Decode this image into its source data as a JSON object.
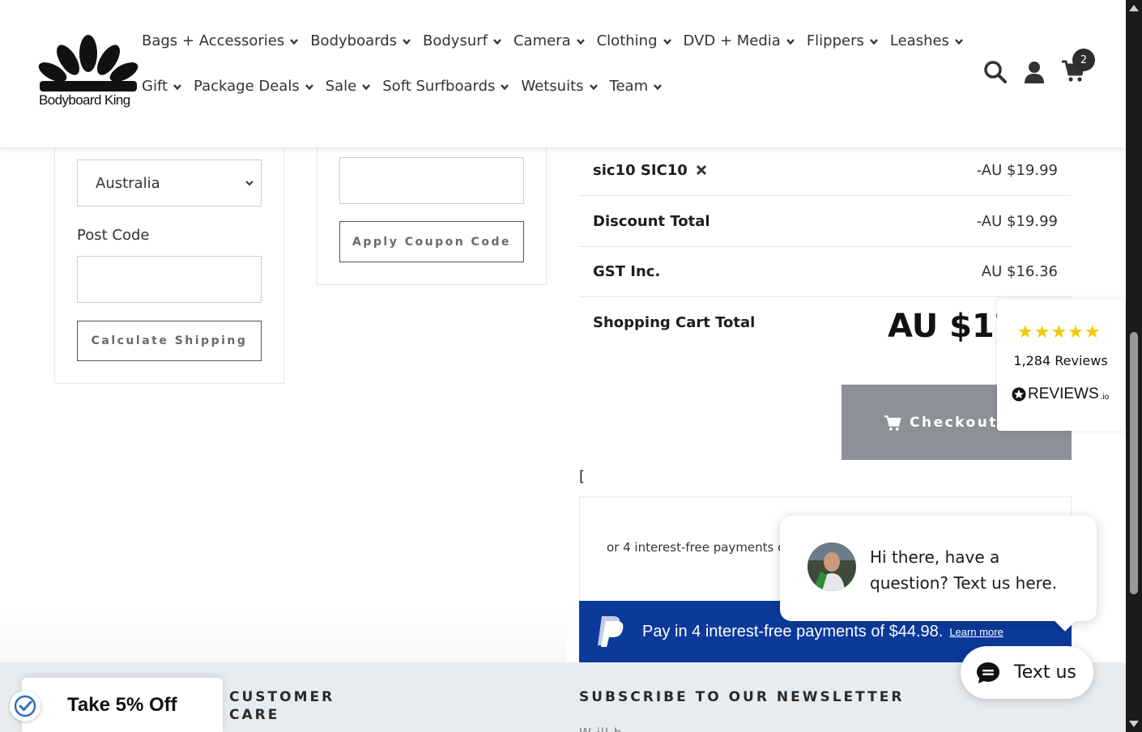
{
  "header": {
    "brand": "Bodyboard King",
    "nav_row1": [
      "Bags + Accessories",
      "Bodyboards",
      "Bodysurf",
      "Camera",
      "Clothing",
      "DVD + Media",
      "Flippers",
      "Leashes"
    ],
    "nav_row2": [
      "Gift",
      "Package Deals",
      "Sale",
      "Soft Surfboards",
      "Wetsuits",
      "Team"
    ],
    "cart_count": "2"
  },
  "shipping": {
    "country": "Australia",
    "postcode_label": "Post Code",
    "calculate_label": "Calculate Shipping"
  },
  "coupon": {
    "apply_label": "Apply Coupon Code"
  },
  "totals": {
    "coupon_code": "sic10 SIC10",
    "coupon_value": "-AU $19.99",
    "discount_label": "Discount Total",
    "discount_value": "-AU $19.99",
    "gst_label": "GST Inc.",
    "gst_value": "AU $16.36",
    "grand_label": "Shopping Cart Total",
    "grand_value": "AU $17",
    "checkout_label": "Checkout N",
    "bracket": "["
  },
  "afterpay": {
    "text": "or 4 interest-free payments of"
  },
  "paypal": {
    "text": "Pay in 4 interest-free payments of $44.98.",
    "learn_more": "Learn more"
  },
  "reviews": {
    "stars": "★★★★★",
    "count": "1,284 Reviews",
    "brand": "REVIEWS",
    "brand_suffix": ".io"
  },
  "chat": {
    "message": "Hi there, have a question? Text us here.",
    "button": "Text us"
  },
  "footer": {
    "customer_care": "CUSTOMER CARE",
    "newsletter": "SUBSCRIBE TO OUR NEWSLETTER",
    "newsletter_cut": "W ill b"
  },
  "promo": {
    "label": "Take 5% Off"
  },
  "colors": {
    "checkout_bg": "#8b9196",
    "paypal_bg": "#0b3a9a",
    "star": "#f4c800",
    "footer_bg": "#e9ecef"
  }
}
